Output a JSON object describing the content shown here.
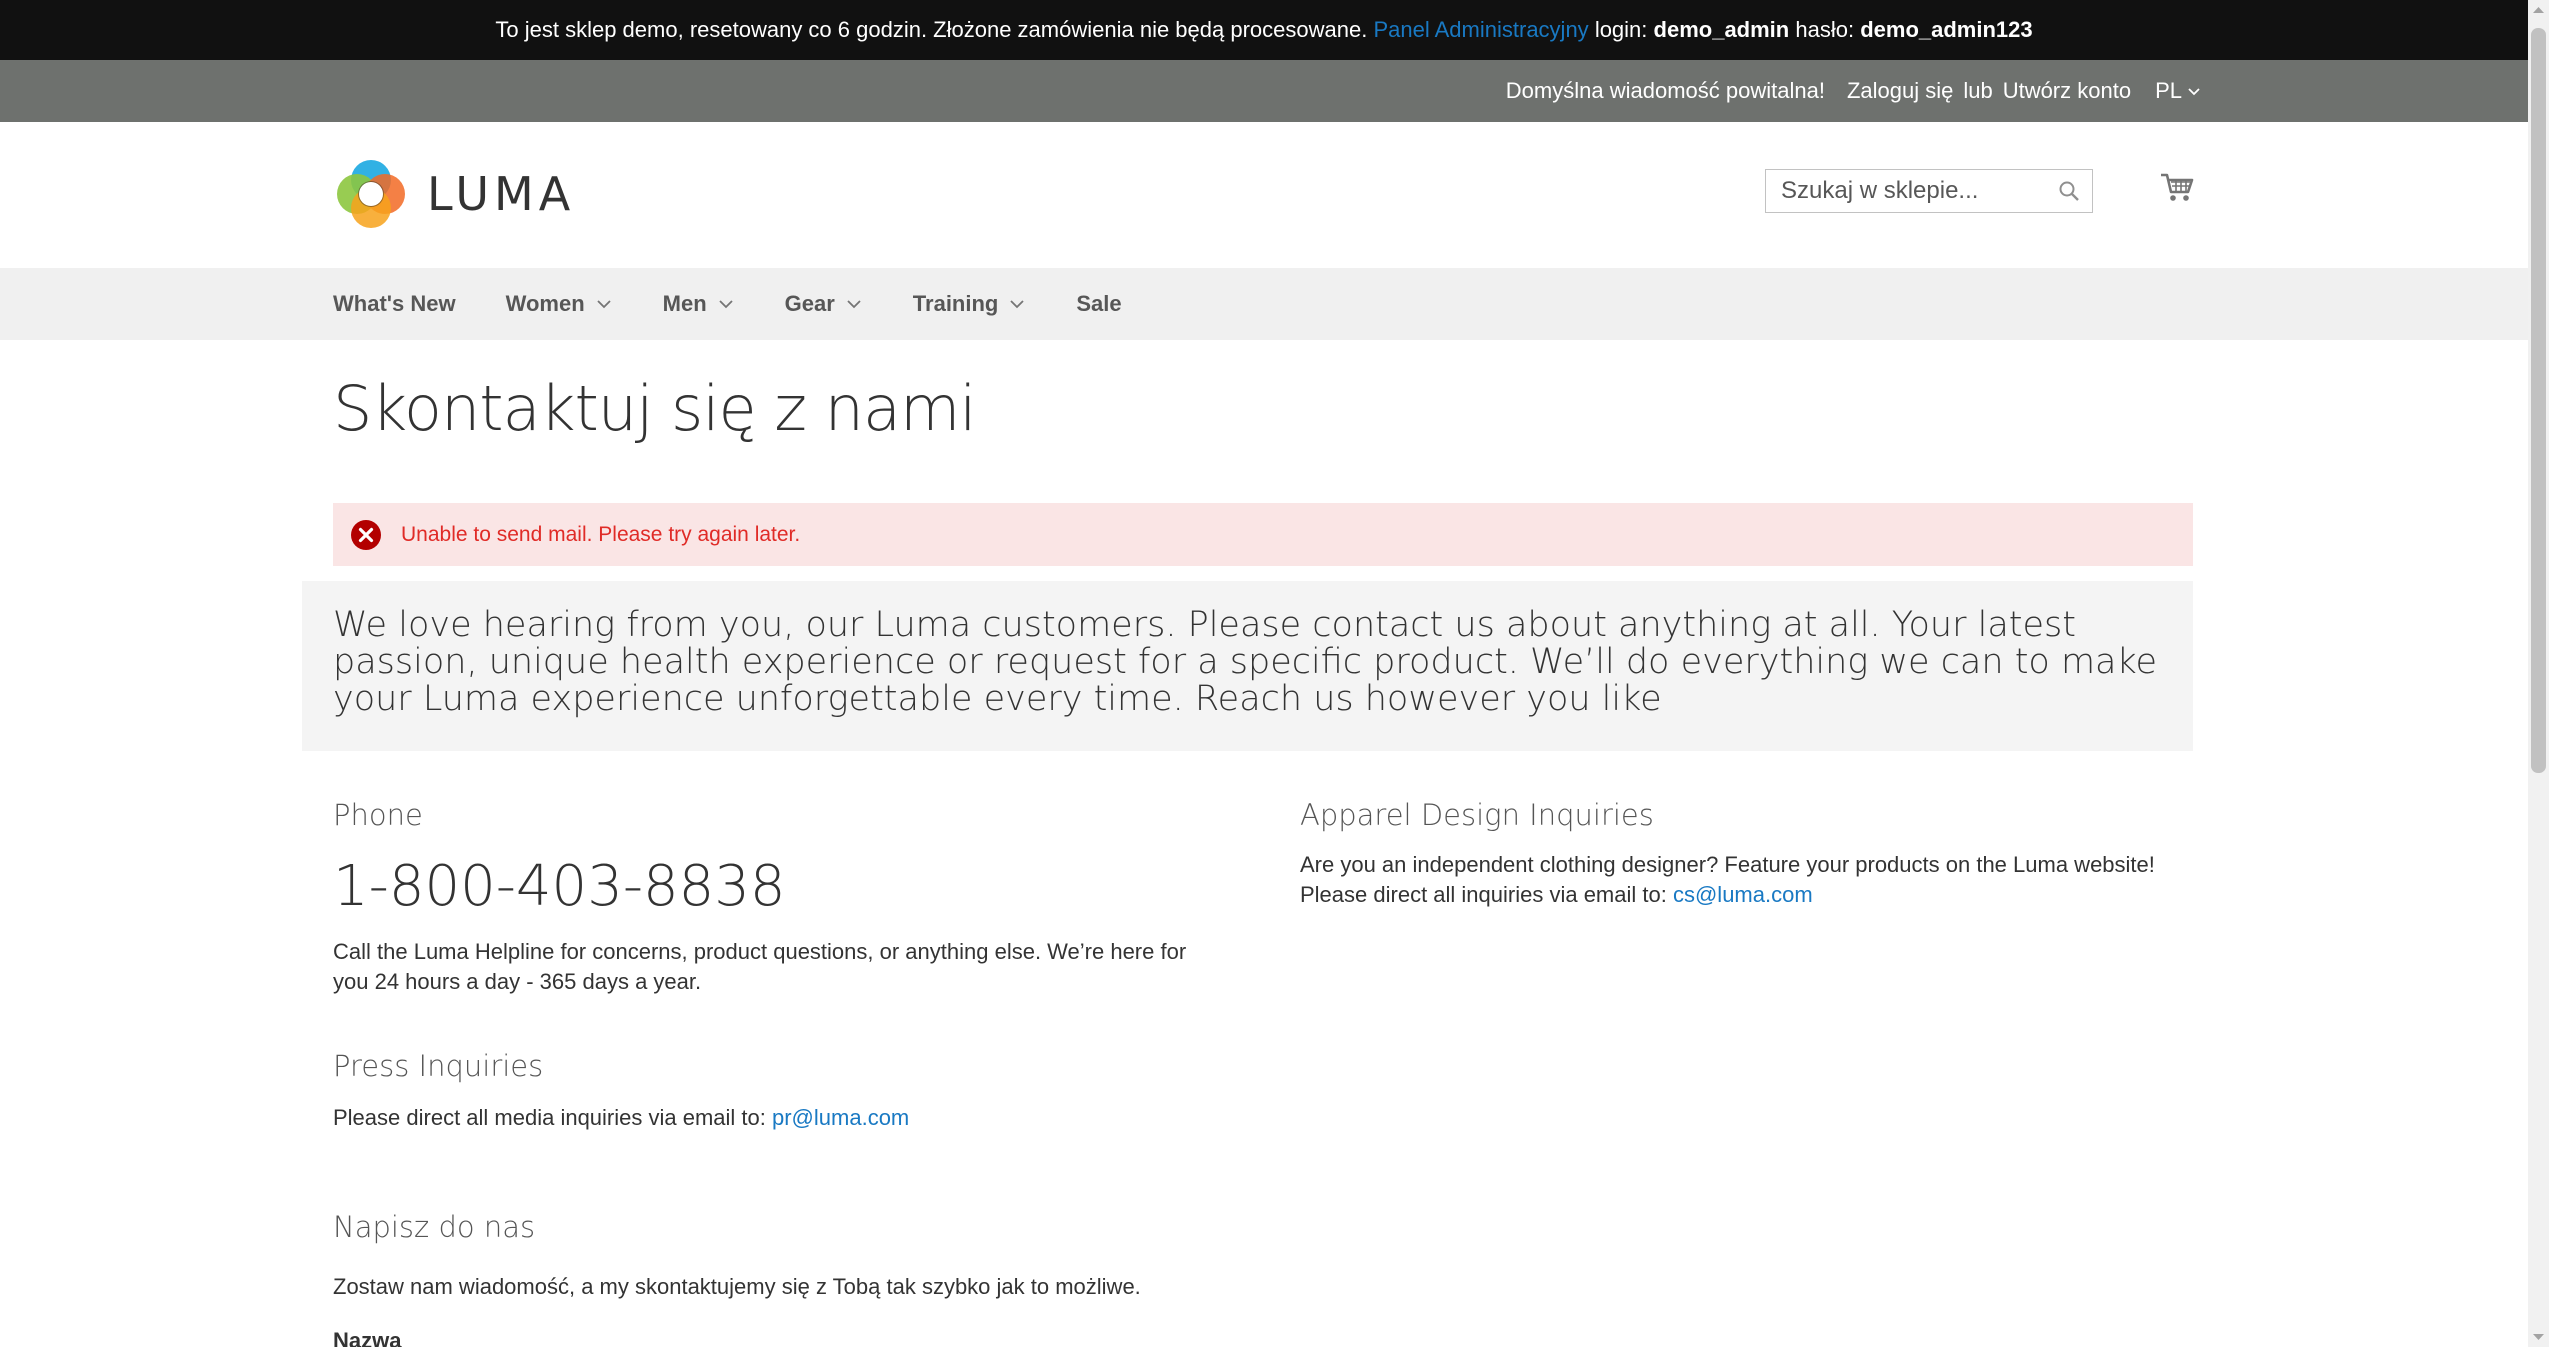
{
  "demo_banner": {
    "text": "To jest sklep demo, resetowany co 6 godzin. Złożone zamówienia nie będą procesowane.",
    "admin_link": "Panel Administracyjny",
    "login_label": "login:",
    "login_value": "demo_admin",
    "password_label": "hasło:",
    "password_value": "demo_admin123"
  },
  "panel": {
    "welcome": "Domyślna wiadomość powitalna!",
    "sign_in": "Zaloguj się",
    "or": "lub",
    "create_account": "Utwórz konto",
    "language": "PL"
  },
  "header": {
    "logo_text": "LUMA",
    "search_placeholder": "Szukaj w sklepie..."
  },
  "nav": {
    "items": [
      {
        "label": "What's New",
        "dropdown": false
      },
      {
        "label": "Women",
        "dropdown": true
      },
      {
        "label": "Men",
        "dropdown": true
      },
      {
        "label": "Gear",
        "dropdown": true
      },
      {
        "label": "Training",
        "dropdown": true
      },
      {
        "label": "Sale",
        "dropdown": false
      }
    ]
  },
  "main": {
    "title": "Skontaktuj się z nami",
    "error_message": "Unable to send mail. Please try again later.",
    "intro": "We love hearing from you, our Luma customers. Please contact us about anything at all. Your latest passion, unique health experience or request for a specific product. We’ll do everything we can to make your Luma experience unforgettable every time. Reach us however you like",
    "phone": {
      "title": "Phone",
      "number": "1-800-403-8838",
      "text": "Call the Luma Helpline for concerns, product questions, or anything else. We’re here for you 24 hours a day - 365 days a year."
    },
    "apparel": {
      "title": "Apparel Design Inquiries",
      "text_line1": "Are you an independent clothing designer? Feature your products on the Luma website!",
      "text_line2": "Please direct all inquiries via email to:",
      "email": "cs@luma.com"
    },
    "press": {
      "title": "Press Inquiries",
      "text": "Please direct all media inquiries via email to:",
      "email": "pr@luma.com"
    },
    "form": {
      "title": "Napisz do nas",
      "subtitle": "Zostaw nam wiadomość, a my skontaktujemy się z Tobą tak szybko jak to możliwe.",
      "name_label": "Nazwa"
    }
  },
  "colors": {
    "banner_bg": "#111111",
    "panel_bg": "#6e716e",
    "nav_bg": "#f0f0f0",
    "link": "#1979c3",
    "error_bg": "#fae5e5",
    "error_text": "#e02b27"
  }
}
